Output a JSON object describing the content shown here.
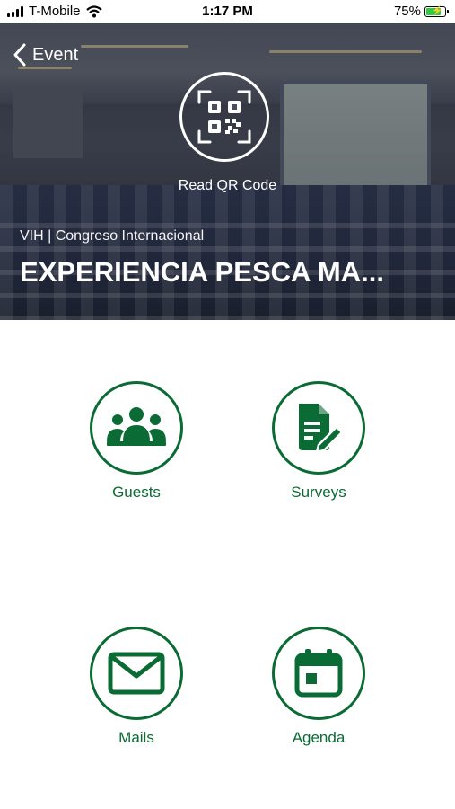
{
  "status_bar": {
    "carrier": "T-Mobile",
    "time": "1:17 PM",
    "battery_percent": "75%",
    "battery_level": 0.75
  },
  "header": {
    "back_label": "Event",
    "qr_label": "Read QR Code",
    "event_subtitle": "VIH | Congreso Internacional",
    "event_title": "EXPERIENCIA PESCA MA..."
  },
  "actions": [
    {
      "label": "Guests",
      "icon": "guests-icon"
    },
    {
      "label": "Surveys",
      "icon": "surveys-icon"
    },
    {
      "label": "Mails",
      "icon": "mail-icon"
    },
    {
      "label": "Agenda",
      "icon": "calendar-icon"
    }
  ],
  "colors": {
    "accent": "#0b6b34",
    "battery": "#2ecc40"
  }
}
